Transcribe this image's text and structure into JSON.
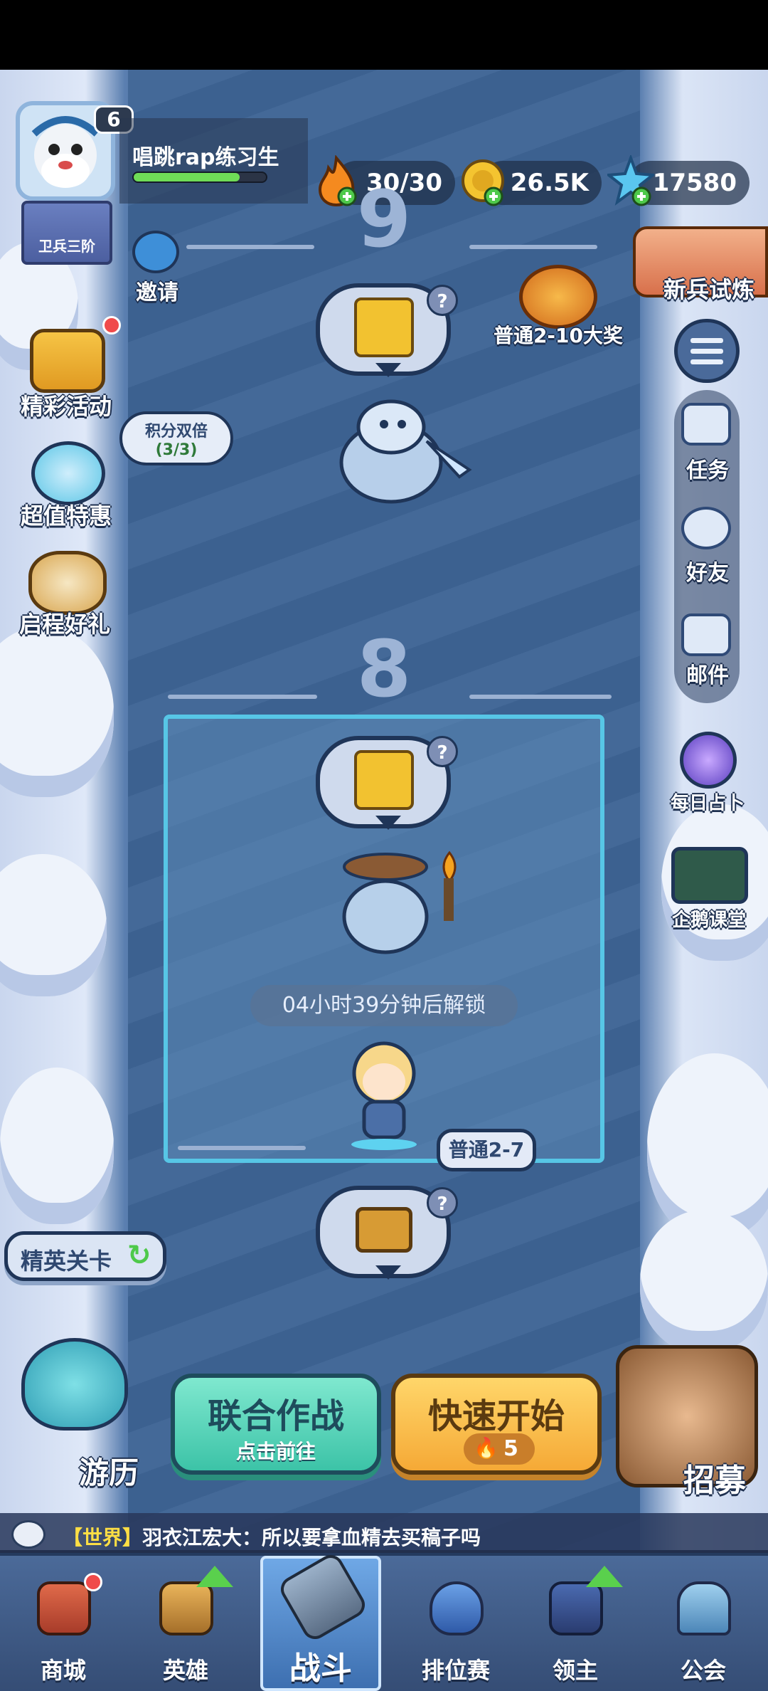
{
  "player": {
    "level": "6",
    "name": "唱跳rap练习生",
    "rank": "卫兵三阶",
    "xp_fraction": 0.8
  },
  "resources": {
    "stamina": "30/30",
    "gold": "26.5K",
    "gems": "17580"
  },
  "left_menu": {
    "invite": "邀请",
    "events": "精彩活动",
    "deals": "超值特惠",
    "deals_badge_title": "积分双倍",
    "deals_badge_count": "(3/3)",
    "starter": "启程好礼",
    "elite": "精英关卡",
    "travel": "游历"
  },
  "right_menu": {
    "trial": "新兵试炼",
    "grand_prize": "普通2-10大奖",
    "tasks": "任务",
    "friends": "好友",
    "mail": "邮件",
    "divination": "每日占卜",
    "classroom": "企鹅课堂",
    "recruit": "招募"
  },
  "stages": {
    "upper_number": "9",
    "current_number": "8",
    "unlock_text": "04小时39分钟后解锁",
    "current_tag": "普通2-7",
    "question_mark": "?"
  },
  "actions": {
    "coop_title": "联合作战",
    "coop_sub": "点击前往",
    "quick_title": "快速开始",
    "quick_cost": "5"
  },
  "chat": {
    "channel": "【世界】",
    "message": "羽衣江宏大：所以要拿血精去买稿子吗"
  },
  "nav": {
    "shop": "商城",
    "heroes": "英雄",
    "battle": "战斗",
    "ranked": "排位赛",
    "lord": "领主",
    "guild": "公会"
  },
  "colors": {
    "river": "#3e6495",
    "selected_border": "#57c6e6",
    "coop_green": "#3cc3a7",
    "quick_orange": "#f5a936"
  }
}
